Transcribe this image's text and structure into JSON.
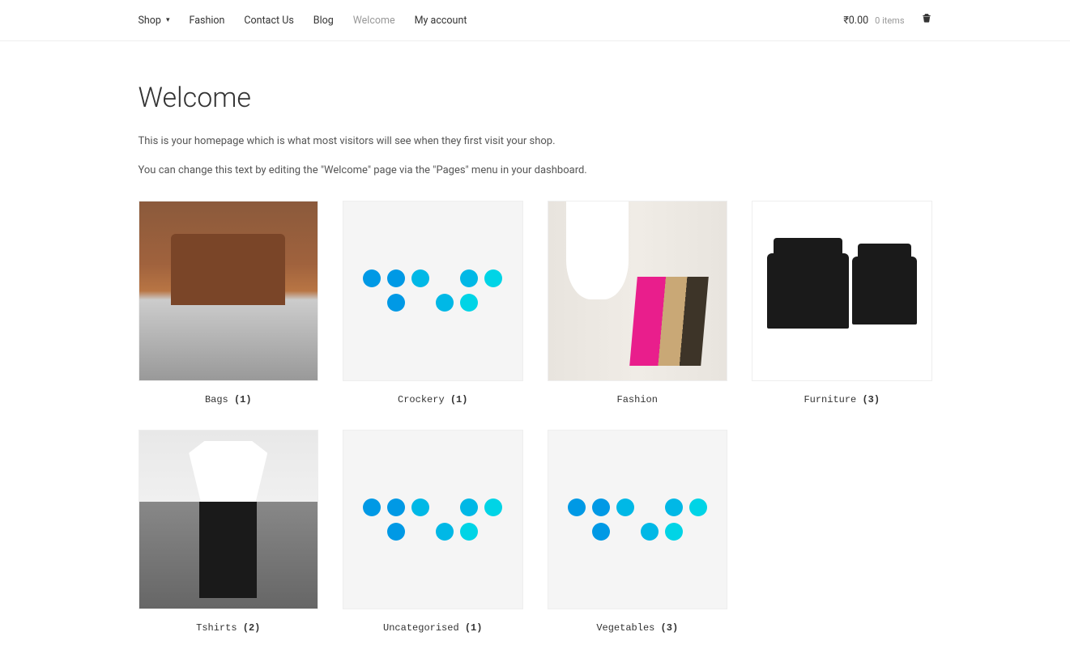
{
  "nav": {
    "items": [
      {
        "label": "Shop",
        "hasDropdown": true
      },
      {
        "label": "Fashion"
      },
      {
        "label": "Contact Us"
      },
      {
        "label": "Blog"
      },
      {
        "label": "Welcome",
        "active": true
      },
      {
        "label": "My account"
      }
    ],
    "cart": {
      "price": "₹0.00",
      "items_text": "0 items"
    }
  },
  "page": {
    "title": "Welcome",
    "intro1": "This is your homepage which is what most visitors will see when they first visit your shop.",
    "intro2": "You can change this text by editing the \"Welcome\" page via the \"Pages\" menu in your dashboard."
  },
  "categories": [
    {
      "name": "Bags",
      "count": "(1)",
      "img": "bags"
    },
    {
      "name": "Crockery",
      "count": "(1)",
      "img": "dots"
    },
    {
      "name": "Fashion",
      "count": "",
      "img": "fashion"
    },
    {
      "name": "Furniture",
      "count": "(3)",
      "img": "furniture"
    },
    {
      "name": "Tshirts",
      "count": "(2)",
      "img": "tshirts"
    },
    {
      "name": "Uncategorised",
      "count": "(1)",
      "img": "dots"
    },
    {
      "name": "Vegetables",
      "count": "(3)",
      "img": "dots"
    }
  ]
}
